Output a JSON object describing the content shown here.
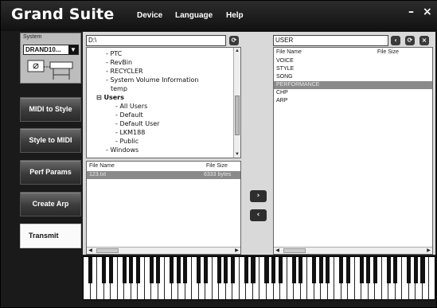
{
  "window": {
    "title": "Grand Suite",
    "menu": [
      "Device",
      "Language",
      "Help"
    ],
    "minimize": "–",
    "close": "×"
  },
  "system": {
    "label": "System",
    "selected": "DRAND10...",
    "icon": "keyboard-stand-icon"
  },
  "sidebar": {
    "items": [
      {
        "label": "MIDI to Style",
        "active": false
      },
      {
        "label": "Style to MIDI",
        "active": false
      },
      {
        "label": "Perf Params",
        "active": false
      },
      {
        "label": "Create Arp",
        "active": false
      },
      {
        "label": "Transmit",
        "active": true
      }
    ]
  },
  "left_pane": {
    "path": "D:\\",
    "tree": [
      {
        "label": "PTC",
        "indent": 1,
        "bold": false,
        "prefix": "-"
      },
      {
        "label": "RevBin",
        "indent": 1,
        "bold": false,
        "prefix": "-"
      },
      {
        "label": "RECYCLER",
        "indent": 1,
        "bold": false,
        "prefix": "-"
      },
      {
        "label": "System Volume Information",
        "indent": 1,
        "bold": false,
        "prefix": "-"
      },
      {
        "label": "temp",
        "indent": 1,
        "bold": false,
        "prefix": ""
      },
      {
        "label": "Users",
        "indent": 0,
        "bold": true,
        "prefix": "⊟"
      },
      {
        "label": "All Users",
        "indent": 2,
        "bold": false,
        "prefix": "-"
      },
      {
        "label": "Default",
        "indent": 2,
        "bold": false,
        "prefix": "-"
      },
      {
        "label": "Default User",
        "indent": 2,
        "bold": false,
        "prefix": "-"
      },
      {
        "label": "LKM188",
        "indent": 2,
        "bold": false,
        "prefix": "-"
      },
      {
        "label": "Public",
        "indent": 2,
        "bold": false,
        "prefix": "-"
      },
      {
        "label": "Windows",
        "indent": 1,
        "bold": false,
        "prefix": "-"
      }
    ],
    "columns": {
      "name": "File Name",
      "size": "File Size"
    },
    "files": [
      {
        "name": "123.txt",
        "size": "6333 bytes",
        "selected": true
      }
    ]
  },
  "right_pane": {
    "path": "USER",
    "columns": {
      "name": "File Name",
      "size": "File Size"
    },
    "files": [
      {
        "name": "VOICE",
        "selected": false
      },
      {
        "name": "STYLE",
        "selected": false
      },
      {
        "name": "SONG",
        "selected": false
      },
      {
        "name": "PERFORMANCE",
        "selected": true
      },
      {
        "name": "CHP",
        "selected": false
      },
      {
        "name": "ARP",
        "selected": false
      }
    ]
  },
  "transfer": {
    "to_right": "›",
    "to_left": "‹"
  },
  "icons": {
    "refresh": "⟳",
    "back": "‹",
    "close": "×"
  }
}
